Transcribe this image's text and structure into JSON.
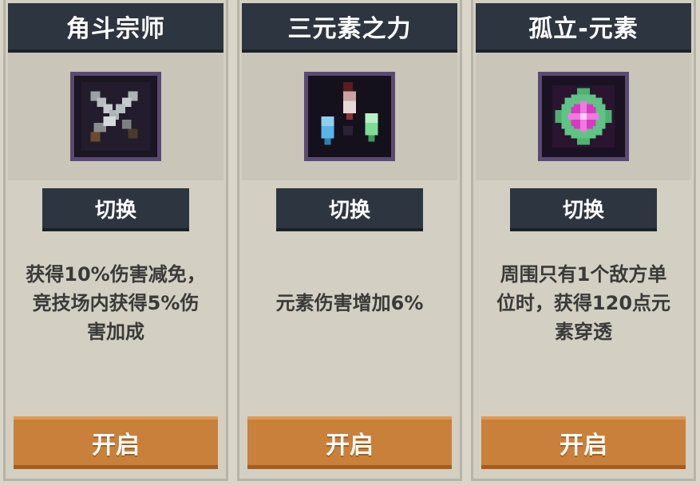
{
  "cards": [
    {
      "title": "角斗宗师",
      "icon": "crossed-swords-icon",
      "switch_label": "切换",
      "description": "获得10%伤害减免，\n竞技场内获得5%伤\n害加成",
      "open_label": "开启"
    },
    {
      "title": "三元素之力",
      "icon": "three-elements-icon",
      "switch_label": "切换",
      "description": "元素伤害增加6%",
      "open_label": "开启"
    },
    {
      "title": "孤立-元素",
      "icon": "isolated-element-icon",
      "switch_label": "切换",
      "description": "周围只有1个敌方单\n位时，获得120点元\n素穿透",
      "open_label": "开启"
    }
  ],
  "colors": {
    "header": "#2d3540",
    "card": "#d3cfc2",
    "open_button": "#c9803a",
    "icon_frame": "#5a4a72"
  }
}
